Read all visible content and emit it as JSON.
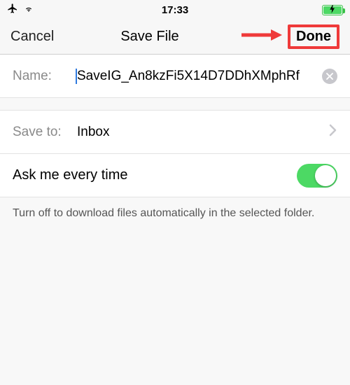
{
  "status_bar": {
    "time": "17:33"
  },
  "nav": {
    "cancel": "Cancel",
    "title": "Save File",
    "done": "Done"
  },
  "name_field": {
    "label": "Name:",
    "value": "SaveIG_An8kzFi5X14D7DDhXMphRf"
  },
  "save_to": {
    "label": "Save to:",
    "value": "Inbox"
  },
  "toggle": {
    "label": "Ask me every time",
    "on": true
  },
  "footer": "Turn off to download files automatically in the selected folder."
}
